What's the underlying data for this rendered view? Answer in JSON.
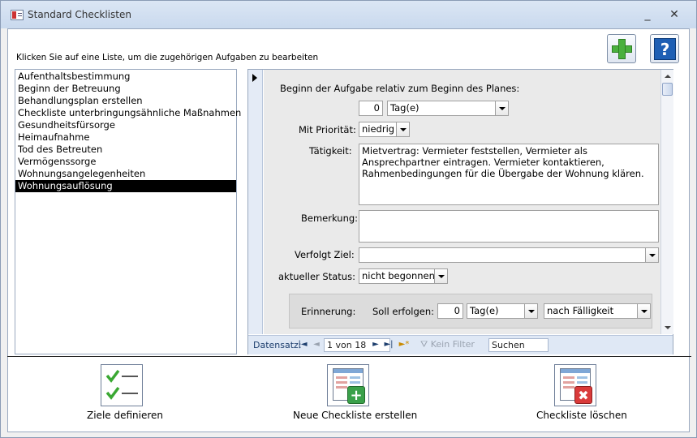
{
  "window": {
    "title": "Standard Checklisten",
    "minimize": "_",
    "close": "✕"
  },
  "instruction": "Klicken Sie auf eine Liste, um die zugehörigen Aufgaben zu bearbeiten",
  "toolbar_icons": {
    "add": "plus-icon",
    "help": "help-icon",
    "help_glyph": "?"
  },
  "list": {
    "items": [
      "Aufenthaltsbestimmung",
      "Beginn der Betreuung",
      "Behandlungsplan erstellen",
      "Checkliste unterbringungsähnliche Maßnahmen",
      "Gesundheitsfürsorge",
      "Heimaufnahme",
      "Tod des Betreuten",
      "Vermögenssorge",
      "Wohnungsangelegenheiten",
      "Wohnungsauflösung"
    ],
    "selected_index": 9
  },
  "form": {
    "start_label": "Beginn der Aufgabe relativ zum Beginn des Planes:",
    "start_value": "0",
    "start_unit": "Tag(e)",
    "priority_label": "Mit Priorität:",
    "priority_value": "niedrig",
    "activity_label": "Tätigkeit:",
    "activity_value": "Mietvertrag: Vermieter feststellen, Vermieter als Ansprechpartner eintragen. Vermieter kontaktieren, Rahmenbedingungen für die Übergabe der Wohnung klären.",
    "remark_label": "Bemerkung:",
    "remark_value": "",
    "goal_label": "Verfolgt Ziel:",
    "goal_value": "",
    "status_label": "aktueller Status:",
    "status_value": "nicht begonnen",
    "reminder_label": "Erinnerung:",
    "reminder_when_label": "Soll erfolgen:",
    "reminder_value": "0",
    "reminder_unit": "Tag(e)",
    "reminder_relation": "nach Fälligkeit"
  },
  "navigator": {
    "caption": "Datensatz:",
    "record": "1 von 18",
    "filter": "Kein Filter",
    "search": "Suchen",
    "first": "|◄",
    "prev": "◄",
    "next": "►",
    "last": "►|",
    "new": "►*"
  },
  "actions": {
    "goals_label": "Ziele definieren",
    "new_label": "Neue Checkliste erstellen",
    "delete_label": "Checkliste löschen"
  }
}
